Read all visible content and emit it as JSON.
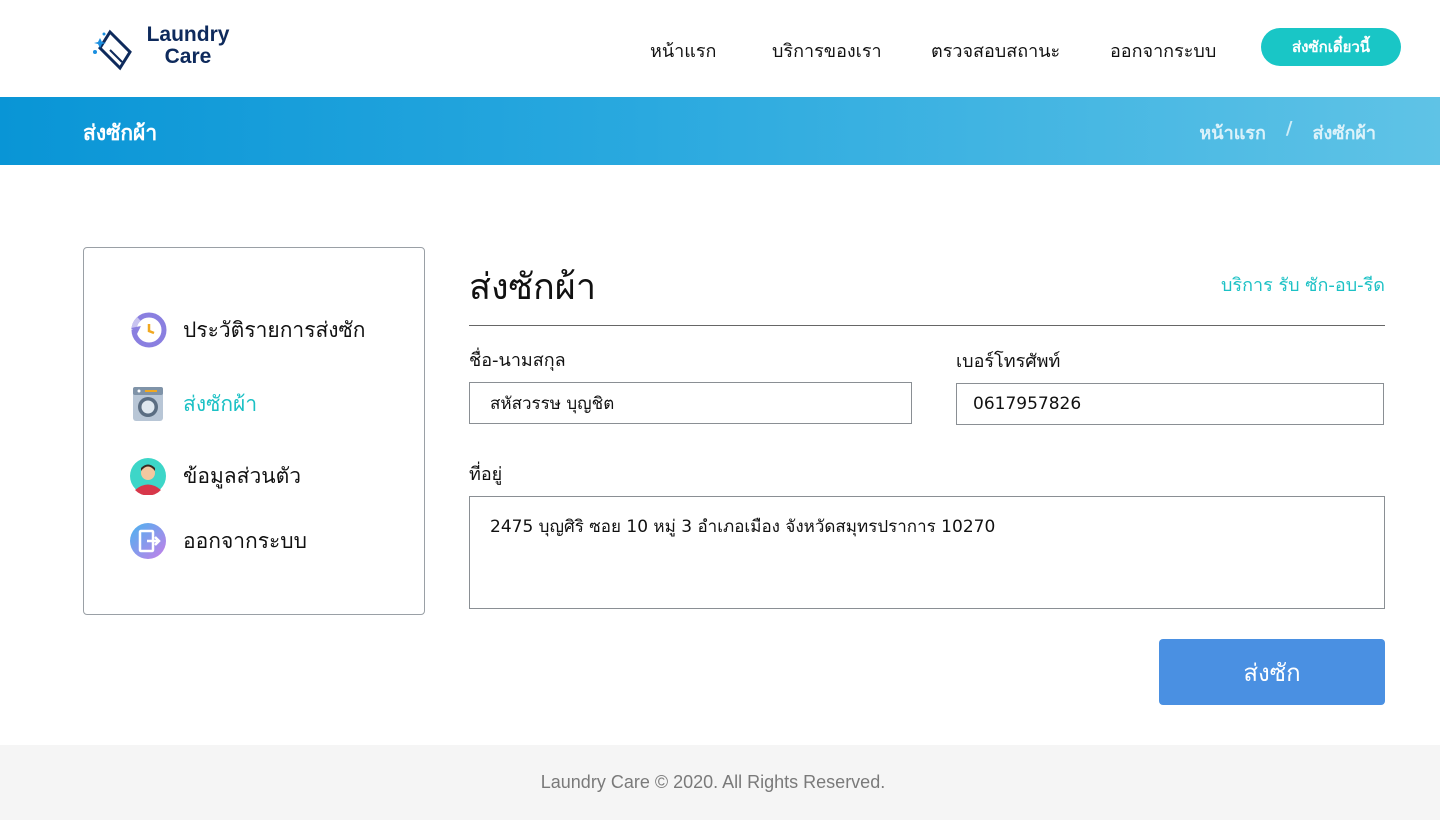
{
  "brand": {
    "line1": "Laundry",
    "line2": "Care"
  },
  "nav": {
    "items": [
      "หน้าแรก",
      "บริการของเรา",
      "ตรวจสอบสถานะ",
      "ออกจากระบบ"
    ],
    "cta": "ส่งซักเดี๋ยวนี้"
  },
  "banner": {
    "title": "ส่งซักผ้า",
    "breadcrumb": [
      "หน้าแรก",
      "/",
      "ส่งซักผ้า"
    ]
  },
  "sidebar": {
    "items": [
      {
        "label": "ประวัติรายการส่งซัก",
        "icon": "history-icon",
        "active": false
      },
      {
        "label": "ส่งซักผ้า",
        "icon": "washing-machine-icon",
        "active": true
      },
      {
        "label": "ข้อมูลส่วนตัว",
        "icon": "user-avatar-icon",
        "active": false
      },
      {
        "label": "ออกจากระบบ",
        "icon": "logout-icon",
        "active": false
      }
    ]
  },
  "form": {
    "title": "ส่งซักผ้า",
    "subtitle": "บริการ รับ ซัก-อบ-รีด",
    "name_label": "ชื่อ-นามสกุล",
    "name_value": "สหัสวรรษ บุญชิต",
    "phone_label": "เบอร์โทรศัพท์",
    "phone_value": "0617957826",
    "address_label": "ที่อยู่",
    "address_value": "2475 บุญศิริ ซอย 10 หมู่ 3 อำเภอเมือง จังหวัดสมุทรปราการ 10270",
    "submit_label": "ส่งซัก"
  },
  "footer": {
    "text": "Laundry Care © 2020. All Rights Reserved."
  },
  "colors": {
    "accent": "#1cc1c5",
    "primary": "#4a90e2",
    "banner_start": "#0995d6",
    "banner_end": "#5fc3e6",
    "brand_dark": "#0e2a5c"
  }
}
